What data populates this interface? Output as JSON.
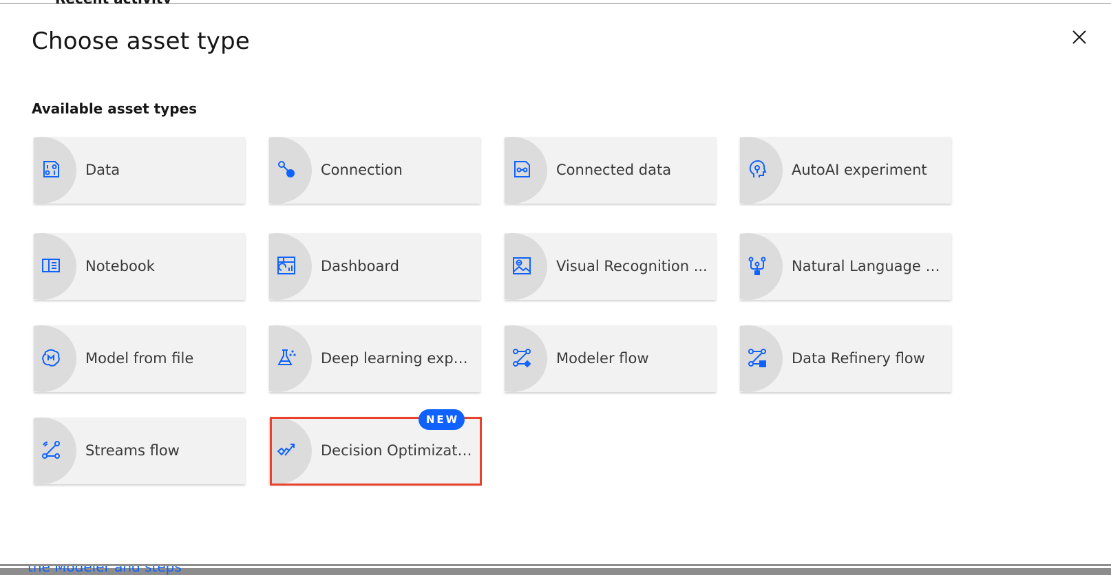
{
  "modal": {
    "title": "Choose asset type",
    "section_heading": "Available asset types",
    "close_icon": "close-icon"
  },
  "accent_color": "#0f62fe",
  "highlight_color": "#e8412c",
  "asset_types": [
    {
      "label": "Data",
      "icon": "data-icon"
    },
    {
      "label": "Connection",
      "icon": "connection-icon"
    },
    {
      "label": "Connected data",
      "icon": "connected-data-icon"
    },
    {
      "label": "AutoAI experiment",
      "icon": "autoai-icon"
    },
    {
      "label": "Notebook",
      "icon": "notebook-icon"
    },
    {
      "label": "Dashboard",
      "icon": "dashboard-icon"
    },
    {
      "label": "Visual Recognition ...",
      "icon": "visual-recognition-icon"
    },
    {
      "label": "Natural Language Cl...",
      "icon": "natural-language-icon"
    },
    {
      "label": "Model from file",
      "icon": "model-icon"
    },
    {
      "label": "Deep learning experi...",
      "icon": "flask-icon"
    },
    {
      "label": "Modeler flow",
      "icon": "modeler-flow-icon"
    },
    {
      "label": "Data Refinery flow",
      "icon": "data-refinery-icon"
    },
    {
      "label": "Streams flow",
      "icon": "streams-flow-icon"
    },
    {
      "label": "Decision Optimizatio...",
      "icon": "decision-optimization-icon",
      "badge": "NEW"
    }
  ]
}
